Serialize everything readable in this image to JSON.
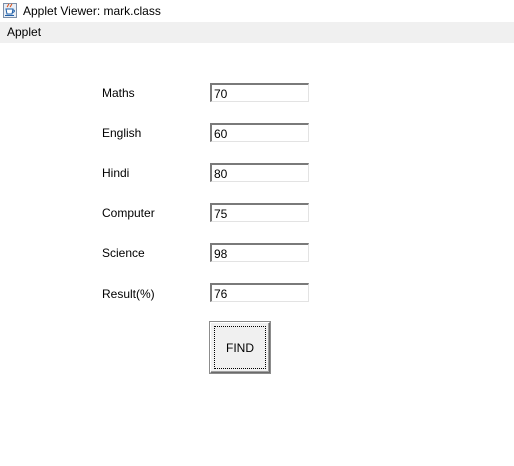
{
  "window": {
    "title": "Applet Viewer: mark.class",
    "icon": "java-cup-icon"
  },
  "menubar": {
    "items": [
      "Applet"
    ]
  },
  "form": {
    "fields": [
      {
        "label": "Maths",
        "value": "70"
      },
      {
        "label": "English",
        "value": "60"
      },
      {
        "label": "Hindi",
        "value": "80"
      },
      {
        "label": "Computer",
        "value": "75"
      },
      {
        "label": "Science",
        "value": "98"
      },
      {
        "label": "Result(%)",
        "value": "76"
      }
    ],
    "find_button_label": "FIND"
  }
}
